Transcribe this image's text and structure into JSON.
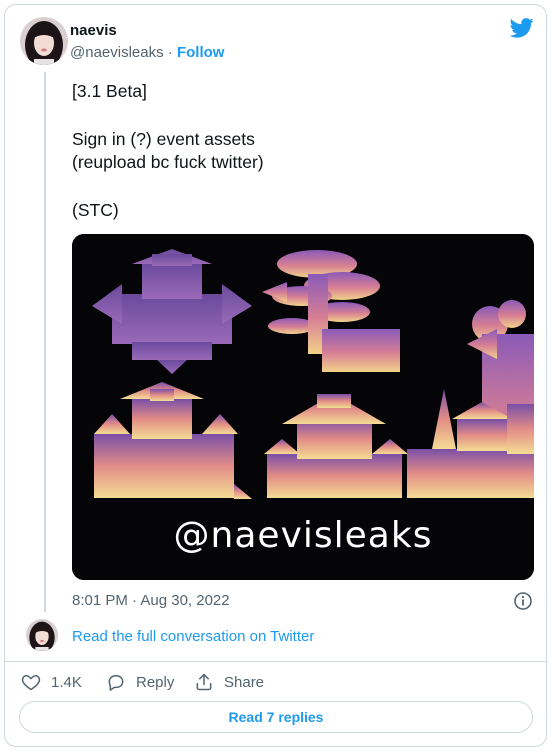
{
  "author": {
    "name": "naevis",
    "handle": "@naevisleaks",
    "separator": " · ",
    "follow_label": "Follow"
  },
  "tweet": {
    "lines": [
      "[3.1 Beta]",
      "Sign in (?) event assets",
      "(reupload bc fuck twitter)",
      "(STC)"
    ],
    "media_watermark": "@naevisleaks",
    "timestamp": "8:01 PM · Aug 30, 2022"
  },
  "conversation_link": "Read the full conversation on Twitter",
  "actions": {
    "like_count": "1.4K",
    "reply_label": "Reply",
    "share_label": "Share"
  },
  "read_replies_label": "Read 7 replies",
  "colors": {
    "accent": "#1d9bf0",
    "secondary_text": "#536471",
    "border": "#cfd9de",
    "media_gradient_top": "#8a5ab8",
    "media_gradient_bottom": "#f2d28a"
  },
  "icons": [
    "twitter-bird-icon",
    "info-icon",
    "heart-icon",
    "reply-bubble-icon",
    "share-icon"
  ]
}
